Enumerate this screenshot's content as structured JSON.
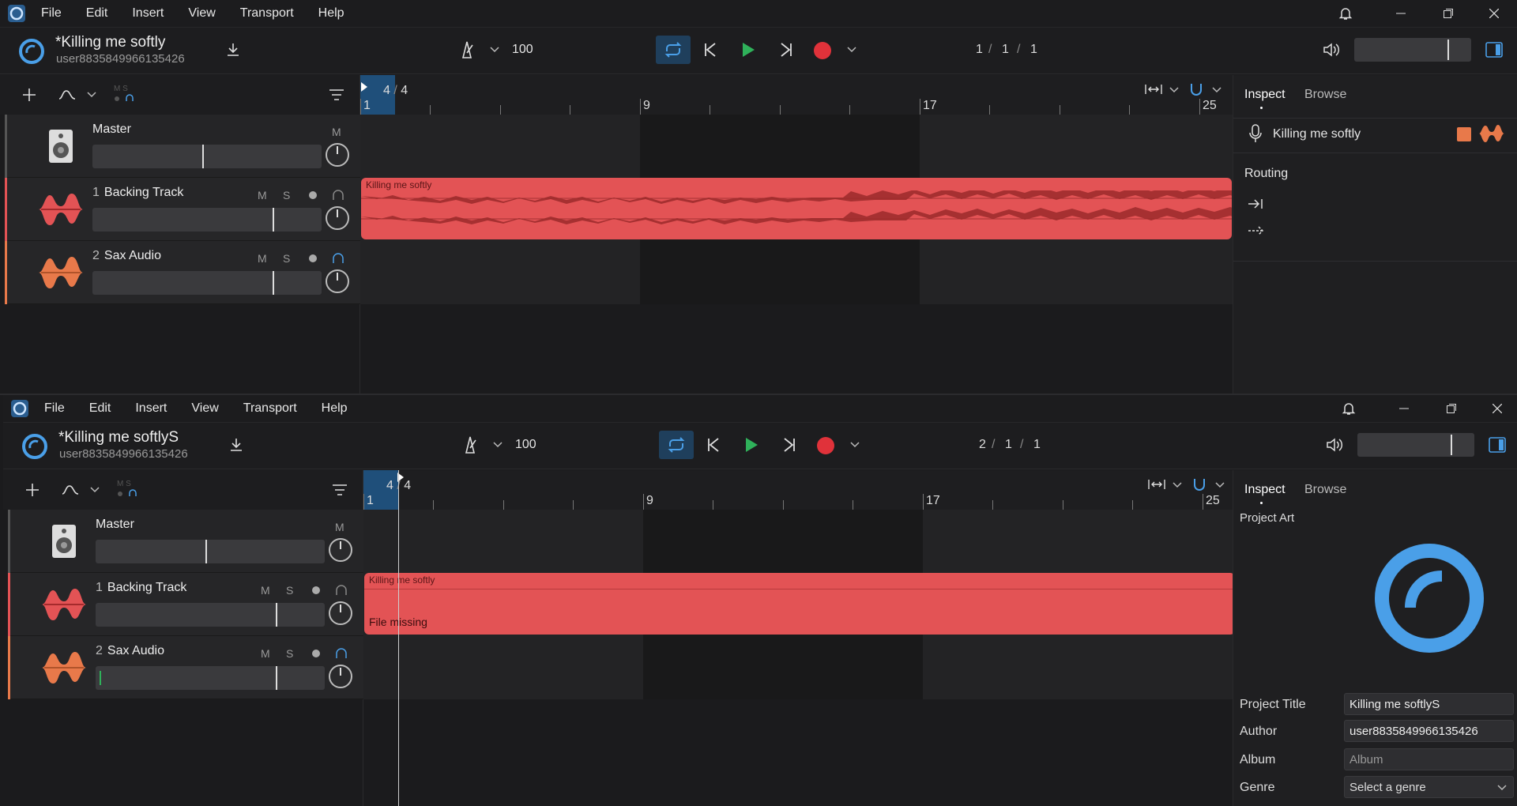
{
  "menu": [
    "File",
    "Edit",
    "Insert",
    "View",
    "Transport",
    "Help"
  ],
  "project": {
    "title_top": "*Killing me softly",
    "title_bottom": "*Killing me softlyS",
    "user": "user8835849966135426"
  },
  "tempo": "100",
  "position_top": {
    "bar": "1",
    "beat": "1",
    "tick": "1"
  },
  "position_bottom": {
    "bar": "2",
    "beat": "1",
    "tick": "1"
  },
  "ruler": {
    "timesig_num": "4",
    "timesig_den": "4",
    "labels": [
      "1",
      "9",
      "17",
      "25"
    ]
  },
  "tracks": {
    "master": {
      "name": "Master",
      "mute": "M"
    },
    "backing": {
      "num": "1",
      "name": "Backing Track",
      "mute": "M",
      "solo": "S"
    },
    "sax": {
      "num": "2",
      "name": "Sax Audio",
      "mute": "M",
      "solo": "S"
    }
  },
  "clip": {
    "title": "Killing me softly",
    "missing": "File missing"
  },
  "inspector": {
    "tab_inspect": "Inspect",
    "tab_browse": "Browse",
    "track_name": "Killing me softly",
    "routing": "Routing",
    "project_art": "Project Art",
    "labels": {
      "title": "Project Title",
      "author": "Author",
      "album": "Album",
      "genre": "Genre"
    },
    "values": {
      "title": "Killing me softlyS",
      "author": "user8835849966135426",
      "album_placeholder": "Album",
      "genre_placeholder": "Select a genre"
    }
  },
  "colors": {
    "accent": "#4a9fe8",
    "clip": "#e35355",
    "record": "#e0323a",
    "play": "#2fb15a",
    "sax": "#e8794a"
  }
}
